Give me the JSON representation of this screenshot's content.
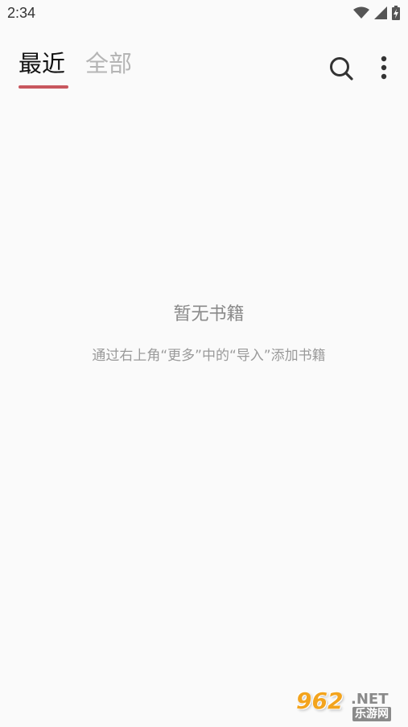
{
  "status_bar": {
    "time": "2:34",
    "icons": [
      "wifi-icon",
      "signal-icon",
      "battery-charging-icon"
    ]
  },
  "tabs": [
    {
      "label": "最近",
      "active": true
    },
    {
      "label": "全部",
      "active": false
    }
  ],
  "toolbar": {
    "search_icon": "search-icon",
    "more_icon": "more-vertical-icon"
  },
  "empty_state": {
    "title": "暂无书籍",
    "hint": "通过右上角“更多”中的“导入”添加书籍"
  },
  "watermark": {
    "main": "962",
    "net": ".NET",
    "cn": "乐游网"
  },
  "colors": {
    "accent": "#c8575e",
    "background": "#fafafa",
    "inactive_tab": "#b5b5b5"
  }
}
